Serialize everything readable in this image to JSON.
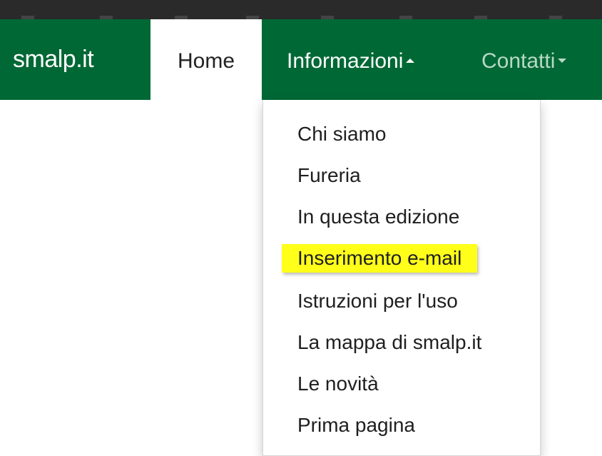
{
  "navbar": {
    "brand": "smalp.it",
    "home_label": "Home",
    "info_label": "Informazioni",
    "contatti_label": "Contatti",
    "background_color": "#006835"
  },
  "dropdown": {
    "items": [
      {
        "label": "Chi siamo"
      },
      {
        "label": "Fureria"
      },
      {
        "label": "In questa edizione"
      },
      {
        "label": "Inserimento e-mail",
        "highlighted": true
      },
      {
        "label": "Istruzioni per l'uso"
      },
      {
        "label": "La mappa di smalp.it"
      },
      {
        "label": "Le novità"
      },
      {
        "label": "Prima pagina"
      }
    ],
    "highlight_color": "#ffff1a"
  },
  "icons": {
    "info_caret": "caret-up-icon",
    "contatti_caret": "caret-down-icon"
  }
}
